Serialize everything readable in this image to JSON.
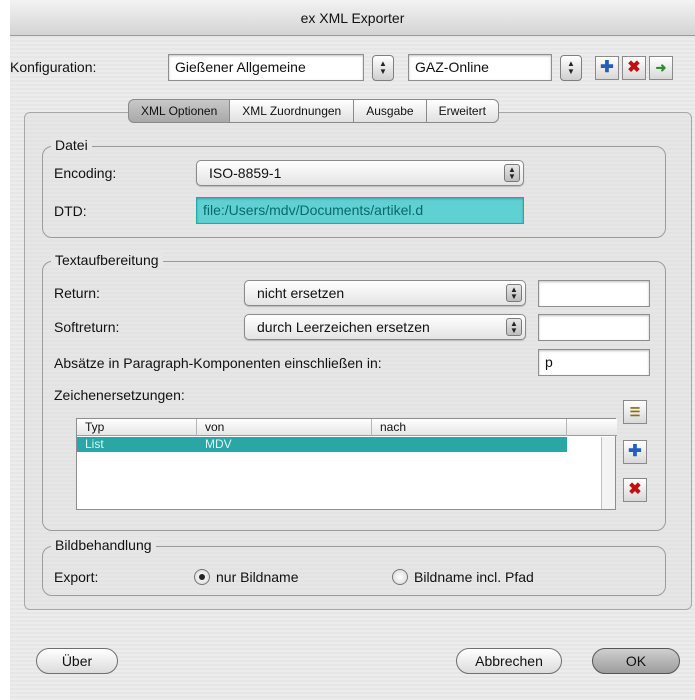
{
  "window": {
    "title": "ex XML Exporter"
  },
  "config": {
    "label": "Konfiguration:",
    "value1": "Gießener Allgemeine",
    "value2": "GAZ-Online"
  },
  "tabs": [
    "XML Optionen",
    "XML Zuordnungen",
    "Ausgabe",
    "Erweitert"
  ],
  "datei": {
    "title": "Datei",
    "encoding_label": "Encoding:",
    "encoding_value": "ISO-8859-1",
    "dtd_label": "DTD:",
    "dtd_value": "file:/Users/mdv/Documents/artikel.d"
  },
  "text": {
    "title": "Textaufbereitung",
    "return_label": "Return:",
    "return_value": "nicht ersetzen",
    "softreturn_label": "Softreturn:",
    "softreturn_value": "durch Leerzeichen ersetzen",
    "absatz_label": "Absätze in Paragraph-Komponenten einschließen in:",
    "absatz_value": "p",
    "zeichen_label": "Zeichenersetzungen:",
    "table": {
      "columns": [
        "Typ",
        "von",
        "nach"
      ],
      "rows": [
        {
          "typ": "List",
          "von": "MDV",
          "nach": ""
        }
      ]
    }
  },
  "bild": {
    "title": "Bildbehandlung",
    "export_label": "Export:",
    "option1": "nur Bildname",
    "option2": "Bildname incl. Pfad",
    "selected": "option1"
  },
  "buttons": {
    "about": "Über",
    "cancel": "Abbrechen",
    "ok": "OK"
  },
  "colors": {
    "selection": "#2aa7a4",
    "add_icon": "#1f5fbf",
    "delete_icon": "#c01010",
    "export_icon": "#2f8f2f"
  }
}
